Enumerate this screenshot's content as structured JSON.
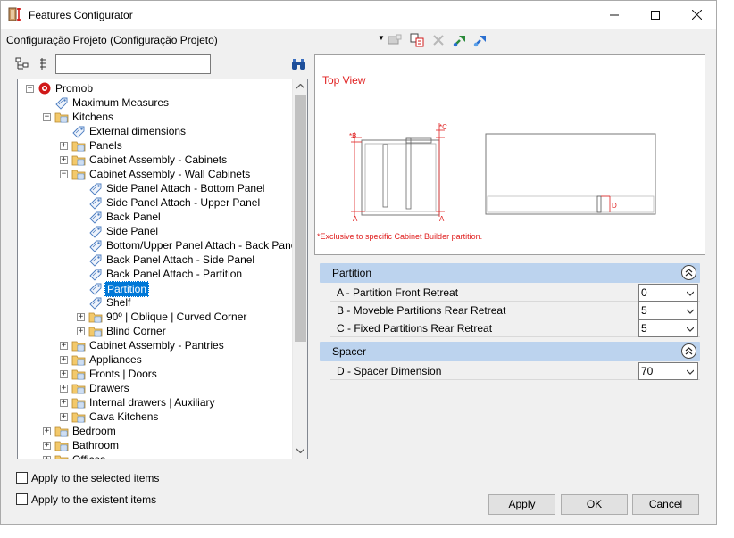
{
  "window": {
    "title": "Features Configurator"
  },
  "config": {
    "selected": "Configuração Projeto (Configuração Projeto)"
  },
  "tree": {
    "items": [
      {
        "label": "Promob",
        "level": 0,
        "expander": "−",
        "icon": "promob-logo-icon"
      },
      {
        "label": "Maximum Measures",
        "level": 1,
        "expander": "",
        "icon": "tag-icon"
      },
      {
        "label": "Kitchens",
        "level": 1,
        "expander": "−",
        "icon": "folder-icon"
      },
      {
        "label": "External dimensions",
        "level": 2,
        "expander": "",
        "icon": "tag-icon"
      },
      {
        "label": "Panels",
        "level": 2,
        "expander": "+",
        "icon": "folder-icon"
      },
      {
        "label": "Cabinet Assembly - Cabinets",
        "level": 2,
        "expander": "+",
        "icon": "folder-icon"
      },
      {
        "label": "Cabinet Assembly - Wall Cabinets",
        "level": 2,
        "expander": "−",
        "icon": "folder-icon"
      },
      {
        "label": "Side Panel Attach - Bottom Panel",
        "level": 3,
        "expander": "",
        "icon": "tag-icon"
      },
      {
        "label": " Side Panel Attach - Upper Panel",
        "level": 3,
        "expander": "",
        "icon": "tag-icon"
      },
      {
        "label": "Back Panel",
        "level": 3,
        "expander": "",
        "icon": "tag-icon"
      },
      {
        "label": "Side Panel",
        "level": 3,
        "expander": "",
        "icon": "tag-icon"
      },
      {
        "label": " Bottom/Upper Panel Attach - Back Panel",
        "level": 3,
        "expander": "",
        "icon": "tag-icon"
      },
      {
        "label": "Back Panel Attach - Side Panel",
        "level": 3,
        "expander": "",
        "icon": "tag-icon"
      },
      {
        "label": "Back Panel Attach - Partition",
        "level": 3,
        "expander": "",
        "icon": "tag-icon"
      },
      {
        "label": "Partition",
        "level": 3,
        "expander": "",
        "icon": "tag-icon",
        "selected": true
      },
      {
        "label": "Shelf",
        "level": 3,
        "expander": "",
        "icon": "tag-icon"
      },
      {
        "label": "90º | Oblique | Curved Corner",
        "level": 3,
        "expander": "+",
        "icon": "folder-icon"
      },
      {
        "label": "Blind Corner",
        "level": 3,
        "expander": "+",
        "icon": "folder-icon"
      },
      {
        "label": "Cabinet Assembly - Pantries",
        "level": 2,
        "expander": "+",
        "icon": "folder-icon"
      },
      {
        "label": "Appliances",
        "level": 2,
        "expander": "+",
        "icon": "folder-icon"
      },
      {
        "label": "Fronts | Doors",
        "level": 2,
        "expander": "+",
        "icon": "folder-icon"
      },
      {
        "label": "Drawers",
        "level": 2,
        "expander": "+",
        "icon": "folder-icon"
      },
      {
        "label": "Internal drawers | Auxiliary",
        "level": 2,
        "expander": "+",
        "icon": "folder-icon"
      },
      {
        "label": "Cava Kitchens",
        "level": 2,
        "expander": "+",
        "icon": "folder-icon"
      },
      {
        "label": "Bedroom",
        "level": 1,
        "expander": "+",
        "icon": "folder-icon"
      },
      {
        "label": "Bathroom",
        "level": 1,
        "expander": "+",
        "icon": "folder-icon"
      },
      {
        "label": "Offices",
        "level": 1,
        "expander": "+",
        "icon": "folder-icon"
      }
    ]
  },
  "checks": {
    "selected_items": "Apply to the selected items",
    "existent_items": "Apply to the existent items"
  },
  "preview": {
    "title": "Top View",
    "note": "*Exclusive to specific Cabinet Builder partition.",
    "labels": {
      "a": "A",
      "b": "*B",
      "c": "*C",
      "d": "D"
    }
  },
  "groups": [
    {
      "title": "Partition",
      "props": [
        {
          "label": "A - Partition Front Retreat",
          "value": "0"
        },
        {
          "label": "B - Moveble Partitions Rear Retreat",
          "value": "5"
        },
        {
          "label": "C - Fixed Partitions Rear Retreat",
          "value": "5"
        }
      ]
    },
    {
      "title": "Spacer",
      "props": [
        {
          "label": "D - Spacer Dimension",
          "value": "70"
        }
      ]
    }
  ],
  "buttons": {
    "apply": "Apply",
    "ok": "OK",
    "cancel": "Cancel"
  },
  "colors": {
    "accent": "#0078d7",
    "group_header": "#bcd3ee",
    "annotation": "#e02020"
  }
}
